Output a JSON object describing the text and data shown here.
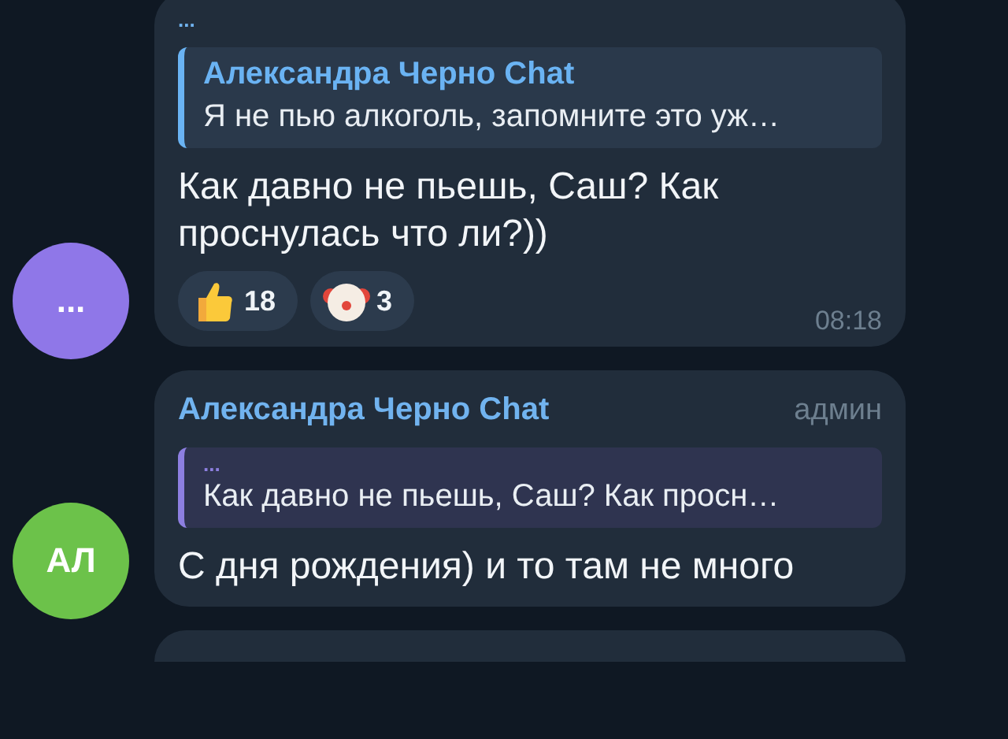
{
  "messages": [
    {
      "sender": "...",
      "reply": {
        "author": "Александра Черно Chat",
        "text": "Я не пью алкоголь, запомните это уж…",
        "color": "#6ab3f3"
      },
      "text": "Как давно не пьешь, Саш? Как проснулась что ли?))",
      "reactions": [
        {
          "kind": "thumbs-up",
          "count": "18"
        },
        {
          "kind": "clown",
          "count": "3"
        }
      ],
      "time": "08:18",
      "avatar": {
        "initials": "...",
        "color": "#8f77e8"
      }
    },
    {
      "sender": "Александра Черно Chat",
      "role": "админ",
      "reply": {
        "author": "...",
        "text": "Как давно не пьешь, Саш? Как просн…",
        "color": "#8d7fe0"
      },
      "text": "С дня рождения) и то там не много",
      "avatar": {
        "initials": "АЛ",
        "color": "#6cc24a"
      }
    }
  ]
}
